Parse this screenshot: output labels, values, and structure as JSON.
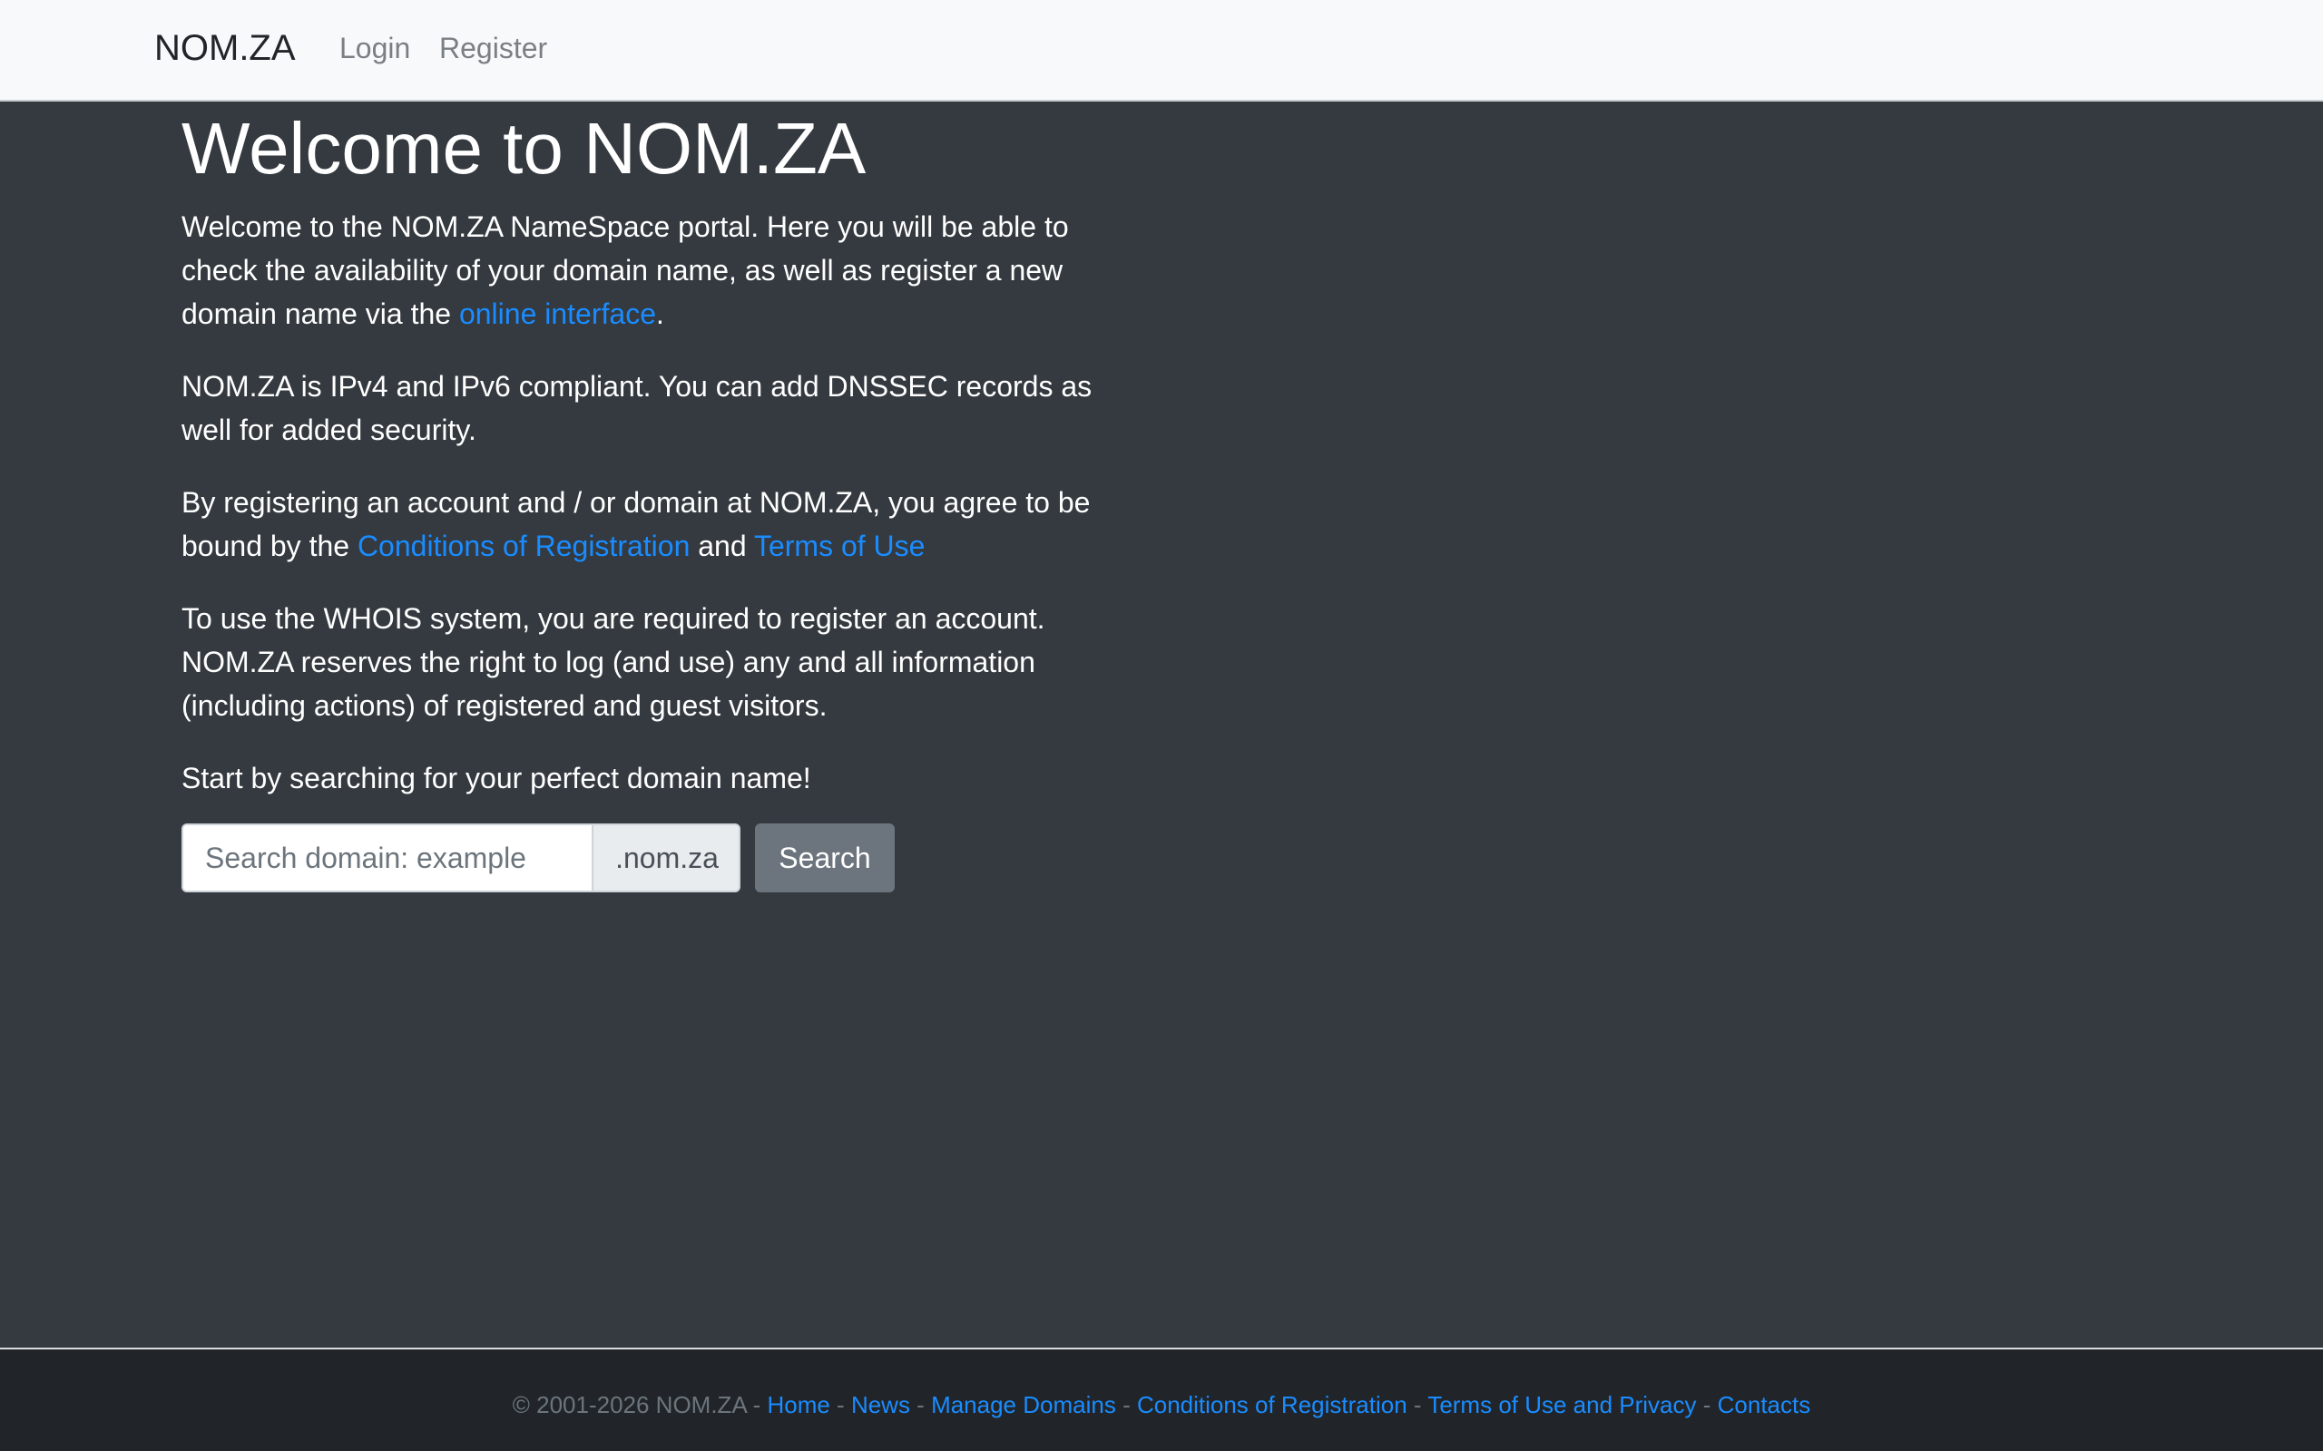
{
  "navbar": {
    "brand": "NOM.ZA",
    "links": [
      {
        "label": "Login"
      },
      {
        "label": "Register"
      }
    ]
  },
  "main": {
    "title": "Welcome to NOM.ZA",
    "p1": {
      "text_before": "Welcome to the NOM.ZA NameSpace portal. Here you will be able to check the availability of your domain name, as well as register a new domain name via the ",
      "link": "online interface",
      "text_after": "."
    },
    "p2": "NOM.ZA is IPv4 and IPv6 compliant. You can add DNSSEC records as well for added security.",
    "p3": {
      "text_before": "By registering an account and / or domain at NOM.ZA, you agree to be bound by the ",
      "link1": "Conditions of Registration",
      "middle": " and ",
      "link2": "Terms of Use"
    },
    "p4": "To use the WHOIS system, you are required to register an account. NOM.ZA reserves the right to log (and use) any and all information (including actions) of registered and guest visitors.",
    "p5": "Start by searching for your perfect domain name!",
    "search": {
      "placeholder": "Search domain: example",
      "value": "",
      "suffix": ".nom.za",
      "button": "Search"
    }
  },
  "footer": {
    "copyright": "© 2001-2026 NOM.ZA",
    "separator": " - ",
    "links": [
      "Home",
      "News",
      "Manage Domains",
      "Conditions of Registration",
      "Terms of Use and Privacy",
      "Contacts"
    ]
  },
  "colors": {
    "background": "#343a40",
    "navbar": "#f8f9fa",
    "link": "#1a8cff",
    "footer": "#212529",
    "button": "#6c757d"
  }
}
